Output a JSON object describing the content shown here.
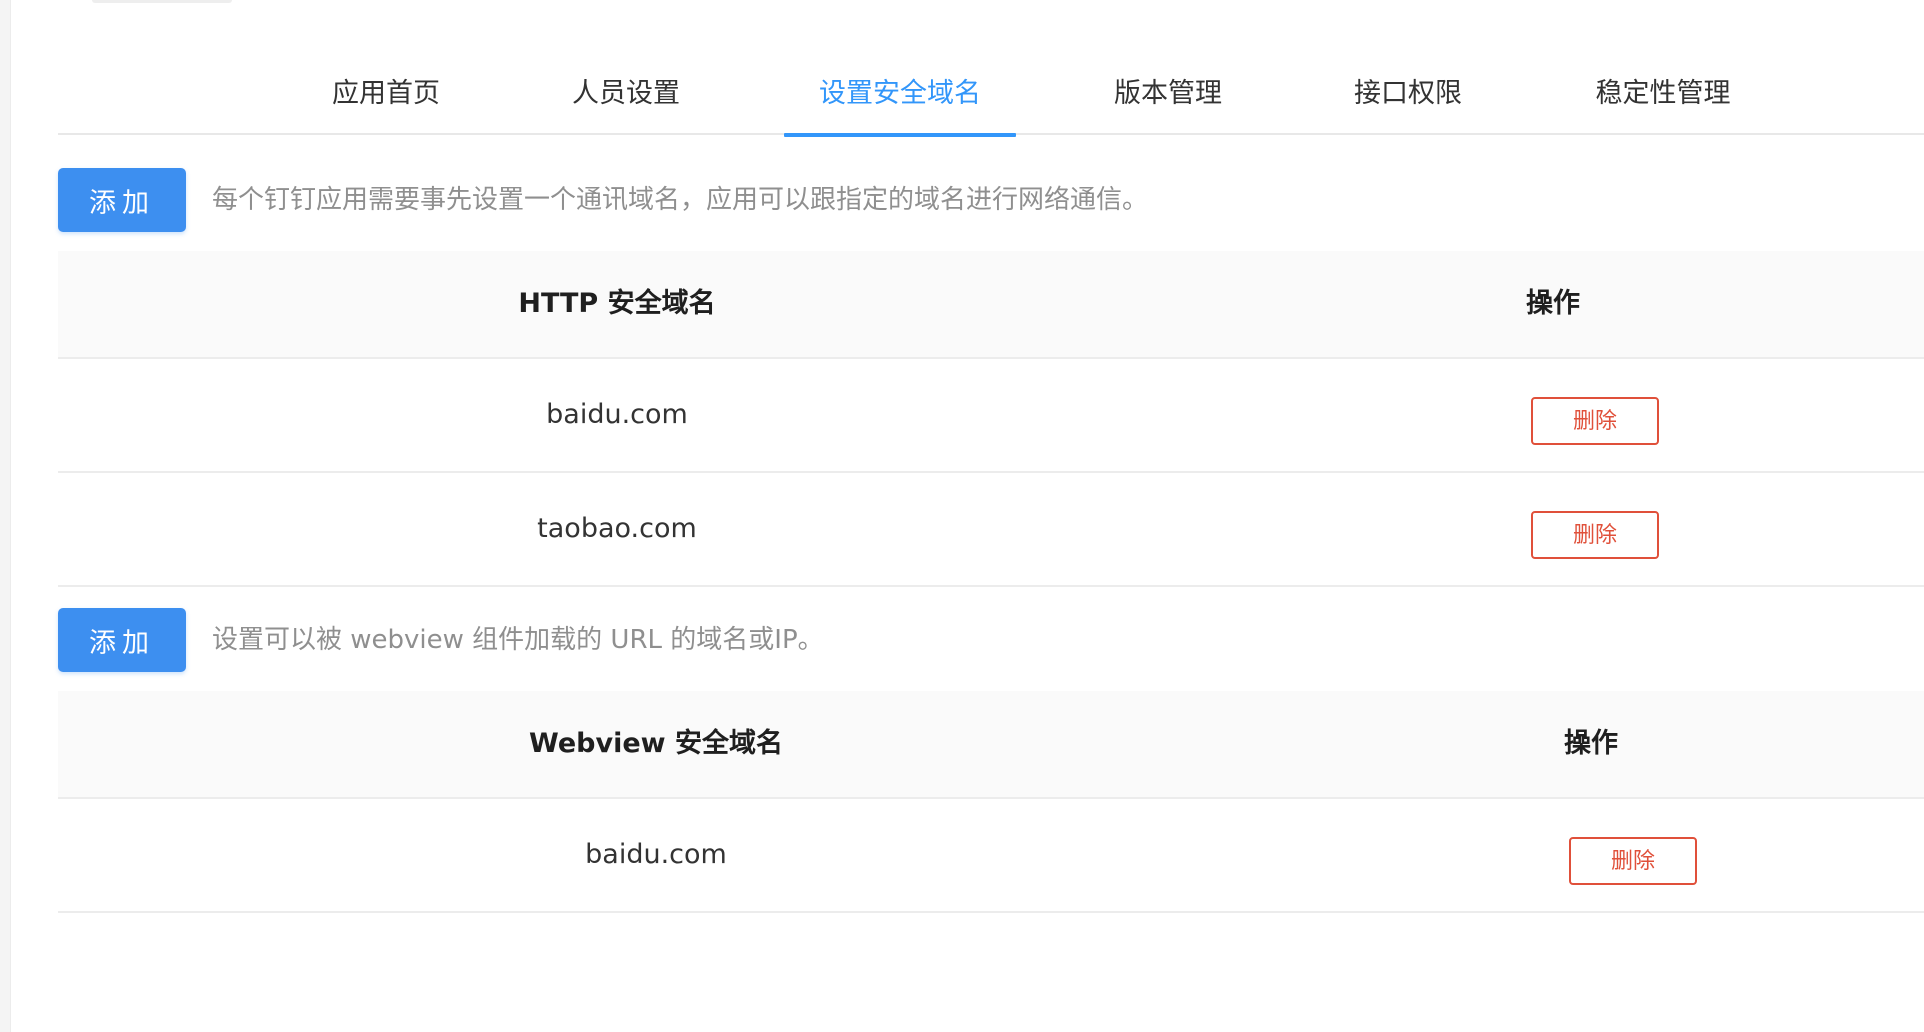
{
  "tabs": [
    {
      "label": "应用首页",
      "active": false
    },
    {
      "label": "人员设置",
      "active": false
    },
    {
      "label": "设置安全域名",
      "active": true
    },
    {
      "label": "版本管理",
      "active": false
    },
    {
      "label": "接口权限",
      "active": false
    },
    {
      "label": "稳定性管理",
      "active": false
    }
  ],
  "http_section": {
    "add_label": "添加",
    "hint": "每个钉钉应用需要事先设置一个通讯域名，应用可以跟指定的域名进行网络通信。",
    "columns": [
      "HTTP 安全域名",
      "操作"
    ],
    "rows": [
      {
        "domain": "baidu.com",
        "action": "删除"
      },
      {
        "domain": "taobao.com",
        "action": "删除"
      }
    ]
  },
  "webview_section": {
    "add_label": "添加",
    "hint": "设置可以被 webview 组件加载的 URL 的域名或IP。",
    "columns": [
      "Webview 安全域名",
      "操作"
    ],
    "rows": [
      {
        "domain": "baidu.com",
        "action": "删除"
      }
    ]
  },
  "colors": {
    "accent": "#3296fa",
    "primary_button": "#3d8ff0",
    "danger": "#e0503a",
    "header_bg": "#fafafa"
  }
}
